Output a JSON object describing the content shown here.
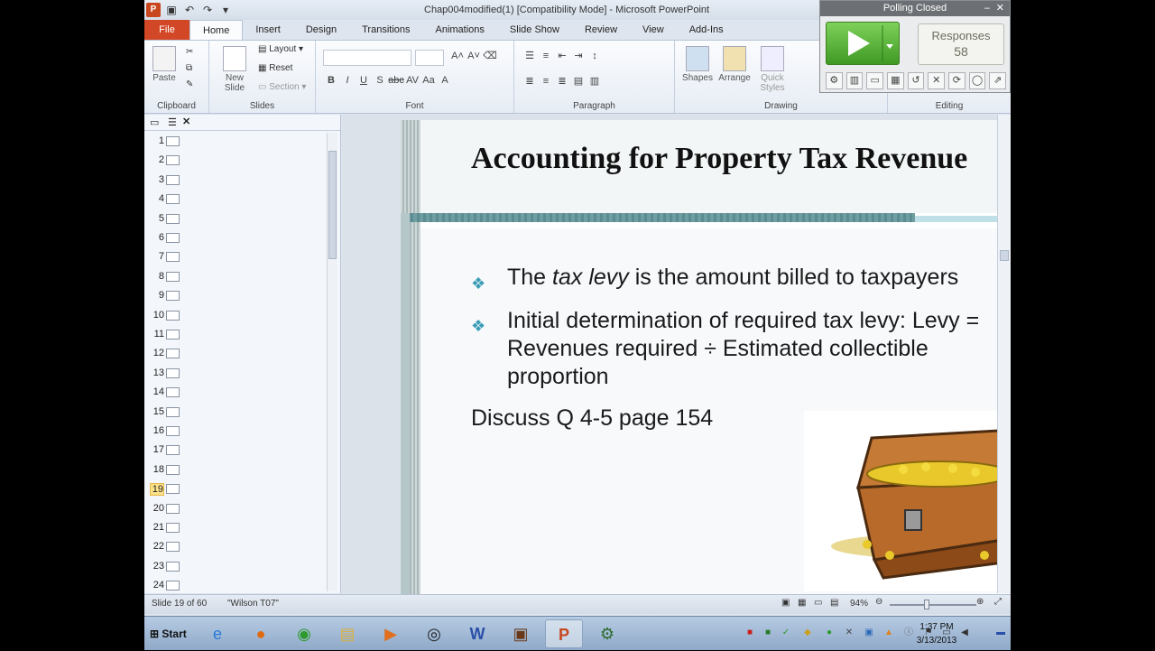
{
  "window": {
    "title": "Chap004modified(1) [Compatibility Mode] - Microsoft PowerPoint"
  },
  "tabs": [
    "File",
    "Home",
    "Insert",
    "Design",
    "Transitions",
    "Animations",
    "Slide Show",
    "Review",
    "View",
    "Add-Ins"
  ],
  "ribbon": {
    "clipboard": {
      "label": "Clipboard",
      "paste": "Paste"
    },
    "slides": {
      "label": "Slides",
      "new_slide": "New Slide",
      "layout": "Layout",
      "reset": "Reset",
      "section": "Section"
    },
    "font": {
      "label": "Font"
    },
    "paragraph": {
      "label": "Paragraph"
    },
    "drawing": {
      "label": "Drawing",
      "shapes": "Shapes",
      "arrange": "Arrange",
      "quick_styles": "Quick Styles"
    },
    "editing": {
      "label": "Editing"
    }
  },
  "poll": {
    "status": "Polling Closed",
    "responses_label": "Responses",
    "responses_count": "58"
  },
  "slides_panel": {
    "numbers": [
      "1",
      "2",
      "3",
      "4",
      "5",
      "6",
      "7",
      "8",
      "9",
      "10",
      "11",
      "12",
      "13",
      "14",
      "15",
      "16",
      "17",
      "18",
      "19",
      "20",
      "21",
      "22",
      "23",
      "24"
    ],
    "selected": 19
  },
  "slide": {
    "title": "Accounting for Property Tax Revenue",
    "bullet1_pre": "The ",
    "bullet1_em": "tax levy",
    "bullet1_post": " is the amount billed to taxpayers",
    "bullet2_line1": "Initial determination of required tax levy: Levy =",
    "bullet2_line2": "Revenues required ÷ Estimated collectible",
    "bullet2_line3": "proportion",
    "discuss": "Discuss Q 4-5 page 154"
  },
  "status": {
    "slide_info": "Slide 19 of 60",
    "theme": "\"Wilson T07\"",
    "zoom": "94%"
  },
  "taskbar": {
    "start": "Start",
    "time": "1:37 PM",
    "date": "3/13/2013"
  }
}
